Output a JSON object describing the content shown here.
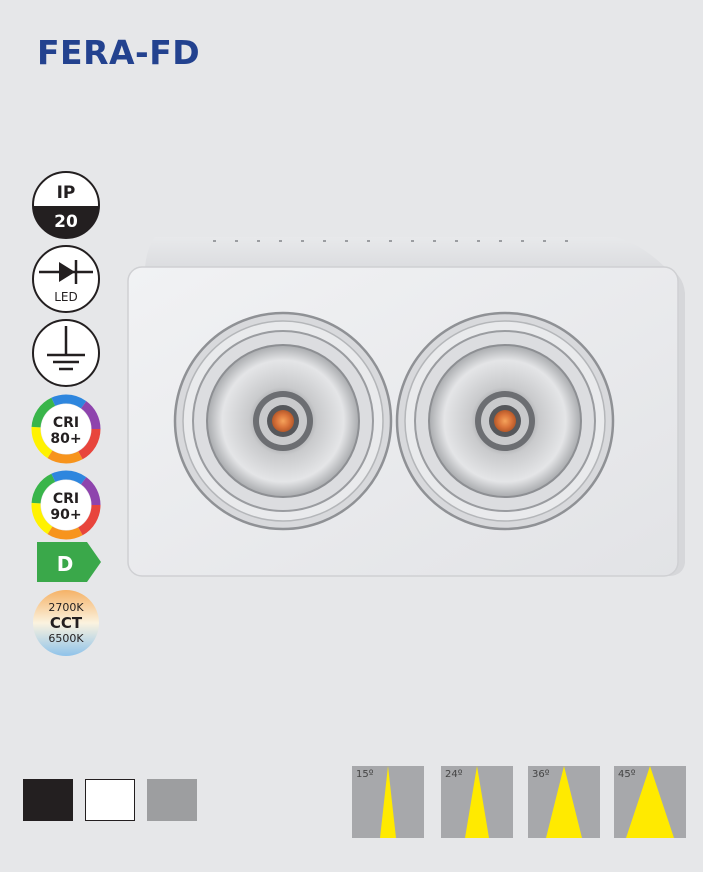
{
  "product": {
    "title": "FERA-FD"
  },
  "badges": {
    "ip": {
      "top": "IP",
      "bottom": "20"
    },
    "led": {
      "label": "LED"
    },
    "cri80": {
      "line1": "CRI",
      "line2": "80+"
    },
    "cri90": {
      "line1": "CRI",
      "line2": "90+"
    },
    "energy_class": "D",
    "cct": {
      "warm": "2700K",
      "label": "CCT",
      "cold": "6500K"
    }
  },
  "finishes": [
    {
      "color": "#231f20"
    },
    {
      "color": "#ffffff"
    },
    {
      "color": "#9d9e a0"
    }
  ],
  "beam_angles": [
    "15º",
    "24º",
    "36º",
    "45º"
  ],
  "colors": {
    "title": "#23428f",
    "background": "#e6e7e9",
    "energy_green": "#3aa84a",
    "beam_yellow": "#ffea00",
    "beam_bg": "#a7a8ab"
  }
}
